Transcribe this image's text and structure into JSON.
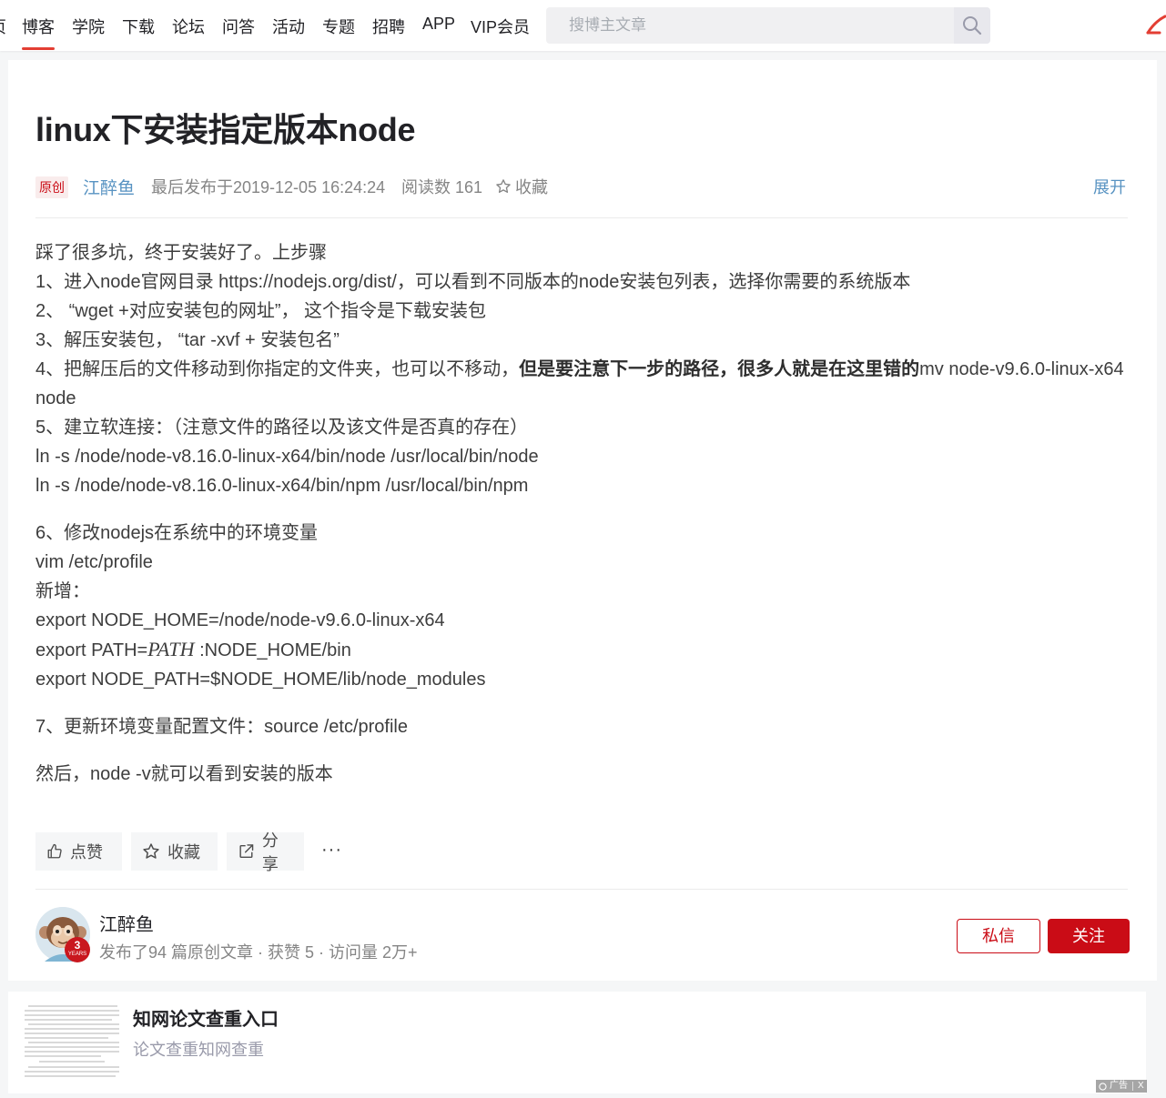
{
  "nav": {
    "items": [
      {
        "label": "页"
      },
      {
        "label": "博客"
      },
      {
        "label": "学院"
      },
      {
        "label": "下载"
      },
      {
        "label": "论坛"
      },
      {
        "label": "问答"
      },
      {
        "label": "活动"
      },
      {
        "label": "专题"
      },
      {
        "label": "招聘"
      },
      {
        "label": "APP"
      },
      {
        "label": "VIP会员"
      }
    ],
    "active": "博客",
    "search_placeholder": "搜博主文章",
    "accent_color": "#e33e33"
  },
  "article": {
    "title": "linux下安装指定版本node",
    "meta": {
      "badge": "原创",
      "author": "江醉鱼",
      "published": "最后发布于2019-12-05 16:24:24",
      "reads": "阅读数 161",
      "favorite": "收藏",
      "expand": "展开"
    },
    "body": {
      "l1": "踩了很多坑，终于安装好了。上步骤",
      "l2": " 1、进入node官网目录 https://nodejs.org/dist/，可以看到不同版本的node安装包列表，选择你需要的系统版本",
      "l3": " 2、 “wget +对应安装包的网址”， 这个指令是下载安装包",
      "l4": " 3、解压安装包，  “tar -xvf   + 安装包名”",
      "l5_pre": "4、把解压后的文件移动到你指定的文件夹，也可以不移动，",
      "l5_bold": "但是要注意下一步的路径，很多人就是在这里错的",
      "l5_post": "mv node-v9.6.0-linux-x64 node",
      "l6": " 5、建立软连接：（注意文件的路径以及该文件是否真的存在）",
      "l7": "ln -s /node/node-v8.16.0-linux-x64/bin/node /usr/local/bin/node",
      "l8": "ln -s /node/node-v8.16.0-linux-x64/bin/npm /usr/local/bin/npm",
      "l9": " 6、修改nodejs在系统中的环境变量",
      "l10": "vim /etc/profile",
      "l11": "新增：",
      "l12": "export NODE_HOME=/node/node-v9.6.0-linux-x64",
      "l13_pre": "export PATH=",
      "l13_var": "PATH",
      "l13_post": ":NODE_HOME/bin",
      "l14": "export NODE_PATH=$NODE_HOME/lib/node_modules",
      "l15": " 7、更新环境变量配置文件：source /etc/profile",
      "l16": "然后，node -v就可以看到安装的版本"
    },
    "actions": {
      "like": "点赞",
      "favorite": "收藏",
      "share": "分享",
      "more": "···"
    }
  },
  "author": {
    "name": "江醉鱼",
    "stats": "发布了94 篇原创文章 · 获赞 5 · 访问量 2万+",
    "years": "3",
    "years_label": "YEARS",
    "message_btn": "私信",
    "follow_btn": "关注",
    "brand_color": "#ca0c16"
  },
  "ad": {
    "title": "知网论文查重入口",
    "subtitle": "论文查重知网查重",
    "tag": "广告",
    "close": "X"
  }
}
